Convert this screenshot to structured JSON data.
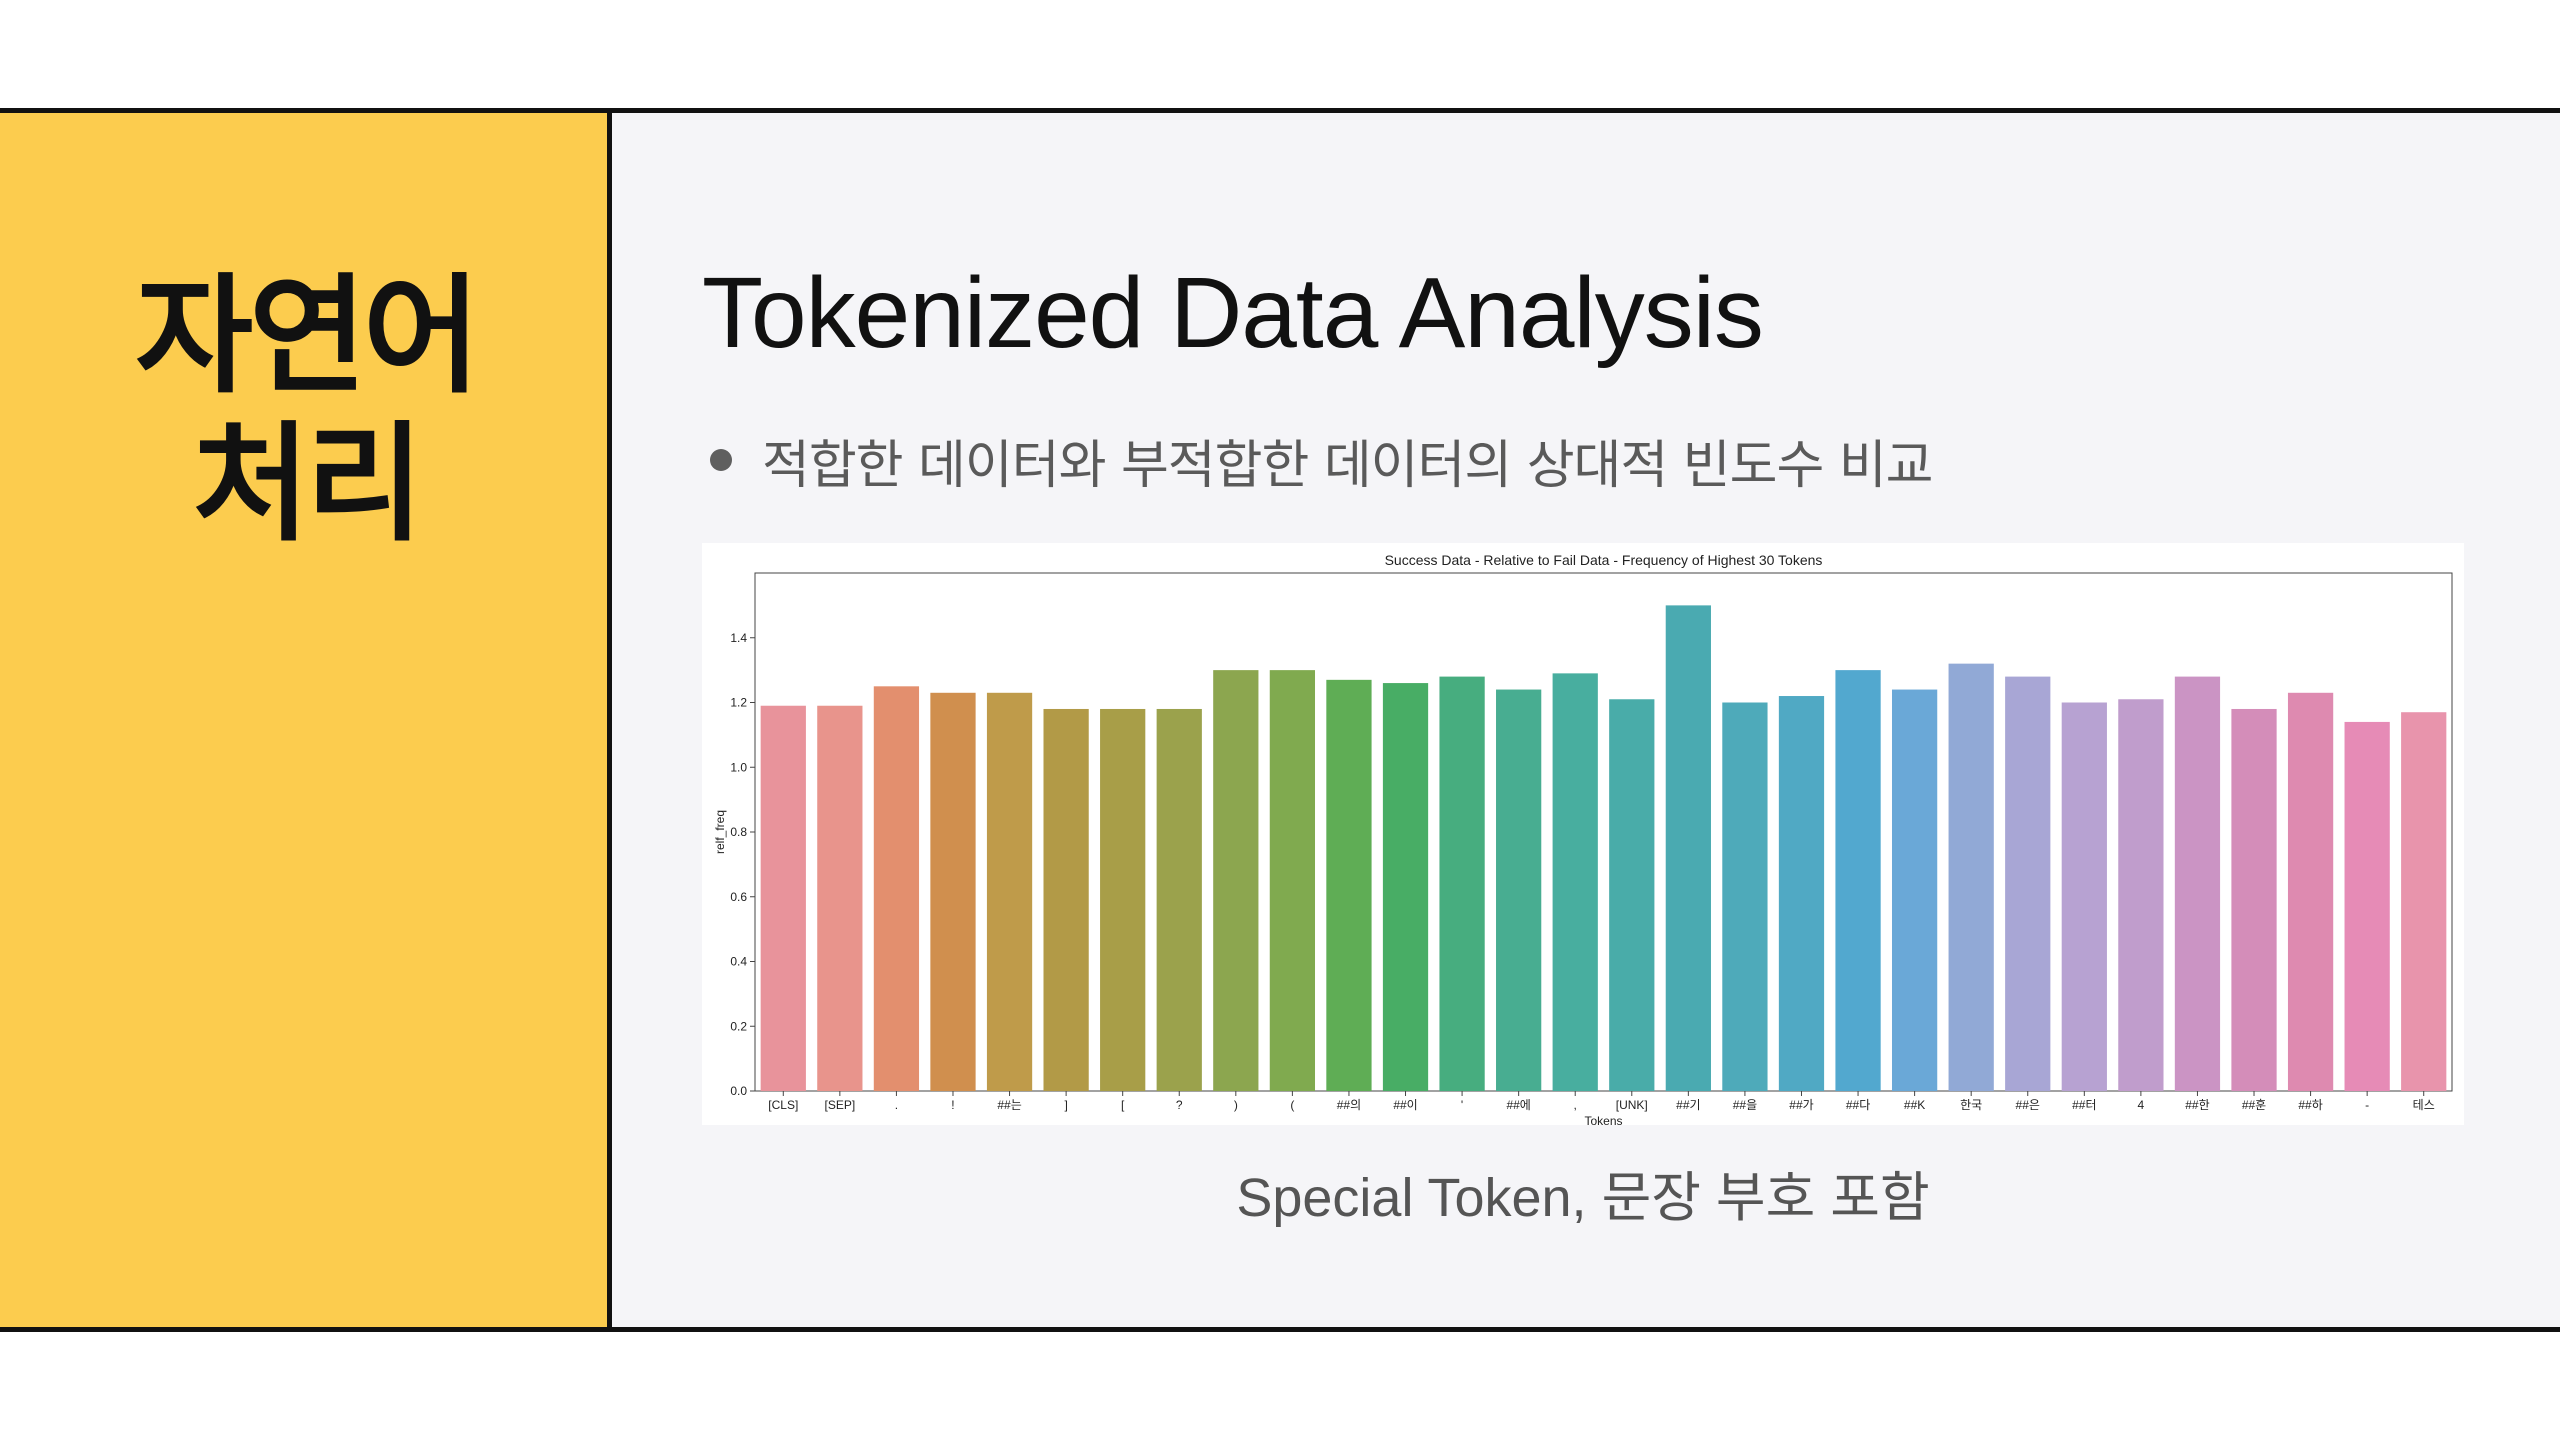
{
  "section": {
    "title_line1": "자연어",
    "title_line2": "처리"
  },
  "header": {
    "title": "Tokenized Data Analysis"
  },
  "bullet": {
    "text": "적합한 데이터와 부적합한 데이터의 상대적 빈도수 비교"
  },
  "caption": "Special Token, 문장 부호 포함",
  "colors": {
    "accent_yellow": "#fccc4e",
    "slide_background": "#f5f5f8",
    "border": "#111111"
  },
  "chart_data": {
    "type": "bar",
    "title": "Success Data - Relative to Fail Data - Frequency of Highest 30 Tokens",
    "xlabel": "Tokens",
    "ylabel": "relf_freq",
    "ylim": [
      0,
      1.6
    ],
    "yticks": [
      "0.0",
      "0.2",
      "0.4",
      "0.6",
      "0.8",
      "1.0",
      "1.2",
      "1.4"
    ],
    "grid": false,
    "categories": [
      "[CLS]",
      "[SEP]",
      ".",
      "!",
      "##는",
      "]",
      "[",
      "?",
      ")",
      "(",
      "##의",
      "##이",
      "'",
      "##에",
      ",",
      "[UNK]",
      "##기",
      "##을",
      "##가",
      "##다",
      "##K",
      "한국",
      "##은",
      "##터",
      "4",
      "##한",
      "##훈",
      "##하",
      "-",
      "테스"
    ],
    "values": [
      1.19,
      1.19,
      1.25,
      1.23,
      1.23,
      1.18,
      1.18,
      1.18,
      1.3,
      1.3,
      1.27,
      1.26,
      1.28,
      1.24,
      1.29,
      1.21,
      1.5,
      1.2,
      1.22,
      1.3,
      1.24,
      1.32,
      1.28,
      1.2,
      1.21,
      1.28,
      1.18,
      1.23,
      1.14,
      1.17
    ],
    "bar_colors": [
      "#e8939b",
      "#e8948c",
      "#e38f6e",
      "#d08f4e",
      "#bf9b4a",
      "#b29a47",
      "#a89e48",
      "#9ba24c",
      "#8ca64f",
      "#80aa4f",
      "#5fad55",
      "#48ad65",
      "#47ad7f",
      "#48ad91",
      "#48ae9f",
      "#49aca9",
      "#4aaab1",
      "#4eaaba",
      "#50a9c4",
      "#52a8cf",
      "#6aa8d7",
      "#91a9d6",
      "#a8a6d5",
      "#b7a2d2",
      "#c09dcc",
      "#cb94c4",
      "#d48db9",
      "#de8ab0",
      "#e68bb6",
      "#e894ac"
    ]
  }
}
